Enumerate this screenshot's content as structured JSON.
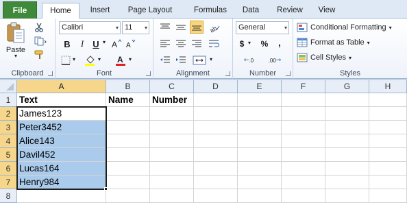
{
  "tabs": {
    "file": "File",
    "home": "Home",
    "insert": "Insert",
    "page_layout": "Page Layout",
    "formulas": "Formulas",
    "data": "Data",
    "review": "Review",
    "view": "View"
  },
  "ribbon": {
    "clipboard": {
      "label": "Clipboard",
      "paste": "Paste"
    },
    "font": {
      "label": "Font",
      "name": "Calibri",
      "size": "11",
      "bold": "B",
      "italic": "I",
      "underline": "U"
    },
    "alignment": {
      "label": "Alignment"
    },
    "number": {
      "label": "Number",
      "format": "General",
      "currency": "$",
      "percent": "%",
      "comma": ",",
      "inc_decimal": ".0",
      "dec_decimal": ".00"
    },
    "styles": {
      "label": "Styles",
      "conditional": "Conditional Formatting",
      "format_table": "Format as Table",
      "cell_styles": "Cell Styles"
    }
  },
  "columns": [
    "A",
    "B",
    "C",
    "D",
    "E",
    "F",
    "G",
    "H"
  ],
  "rows": [
    "1",
    "2",
    "3",
    "4",
    "5",
    "6",
    "7",
    "8"
  ],
  "cells": {
    "A1": "Text",
    "B1": "Name",
    "C1": "Number",
    "A2": "James123",
    "A3": "Peter3452",
    "A4": "Alice143",
    "A5": "Davil452",
    "A6": "Lucas164",
    "A7": "Henry984"
  },
  "colors": {
    "file_tab": "#3e8a3a",
    "selection": "#aacbeb",
    "header_selected": "#f5d68a"
  }
}
